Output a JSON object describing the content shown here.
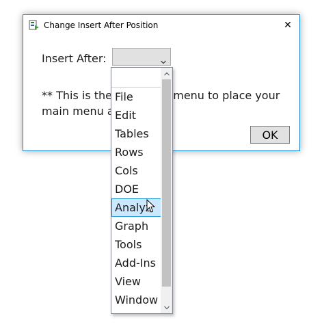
{
  "window": {
    "title": "Change Insert After Position",
    "close_glyph": "✕"
  },
  "form": {
    "insert_after_label": "Insert After:",
    "selected_value": ""
  },
  "note": {
    "line1_start": "**  This is the",
    "line1_end": "n menu to place your",
    "line2_start": "main menu a"
  },
  "buttons": {
    "ok_label": "OK"
  },
  "dropdown": {
    "items": [
      "File",
      "Edit",
      "Tables",
      "Rows",
      "Cols",
      "DOE",
      "Analyz",
      "Graph",
      "Tools",
      "Add-Ins",
      "View",
      "Window"
    ],
    "selected_index": 6
  },
  "colors": {
    "accent": "#1883d7",
    "selection_bg": "#cce8ff",
    "selection_border": "#26a0da"
  },
  "icons": {
    "app": "app-icon",
    "close": "close-icon",
    "combo_arrow": "chevron-down-icon",
    "scroll_up": "scroll-up-icon",
    "scroll_down": "scroll-down-icon",
    "cursor": "mouse-pointer-icon"
  }
}
